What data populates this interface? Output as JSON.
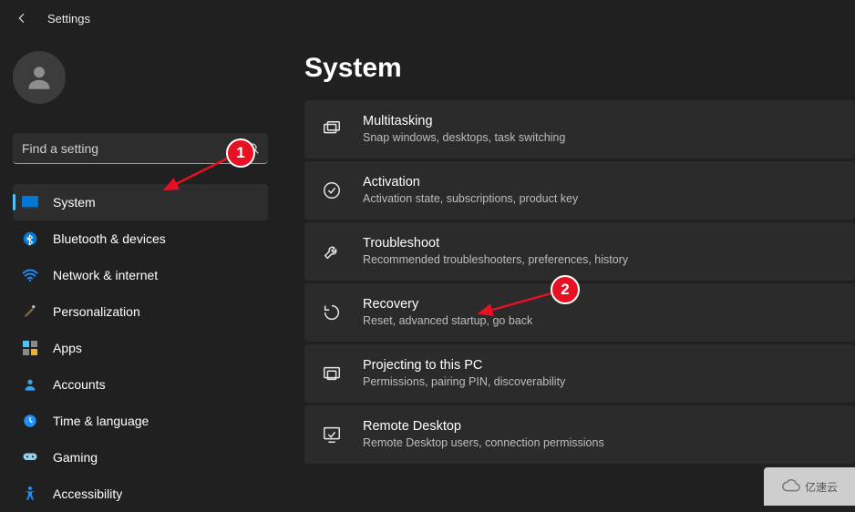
{
  "titlebar": {
    "title": "Settings"
  },
  "search": {
    "placeholder": "Find a setting"
  },
  "sidebar": {
    "items": [
      {
        "label": "System"
      },
      {
        "label": "Bluetooth & devices"
      },
      {
        "label": "Network & internet"
      },
      {
        "label": "Personalization"
      },
      {
        "label": "Apps"
      },
      {
        "label": "Accounts"
      },
      {
        "label": "Time & language"
      },
      {
        "label": "Gaming"
      },
      {
        "label": "Accessibility"
      }
    ]
  },
  "page": {
    "title": "System"
  },
  "cards": [
    {
      "title": "Multitasking",
      "desc": "Snap windows, desktops, task switching"
    },
    {
      "title": "Activation",
      "desc": "Activation state, subscriptions, product key"
    },
    {
      "title": "Troubleshoot",
      "desc": "Recommended troubleshooters, preferences, history"
    },
    {
      "title": "Recovery",
      "desc": "Reset, advanced startup, go back"
    },
    {
      "title": "Projecting to this PC",
      "desc": "Permissions, pairing PIN, discoverability"
    },
    {
      "title": "Remote Desktop",
      "desc": "Remote Desktop users, connection permissions"
    }
  ],
  "annotations": {
    "badge1": "1",
    "badge2": "2"
  },
  "watermark": "亿速云",
  "colors": {
    "accent": "#4cc2ff",
    "anno_red": "#e81123",
    "card_bg": "#2b2b2b"
  }
}
